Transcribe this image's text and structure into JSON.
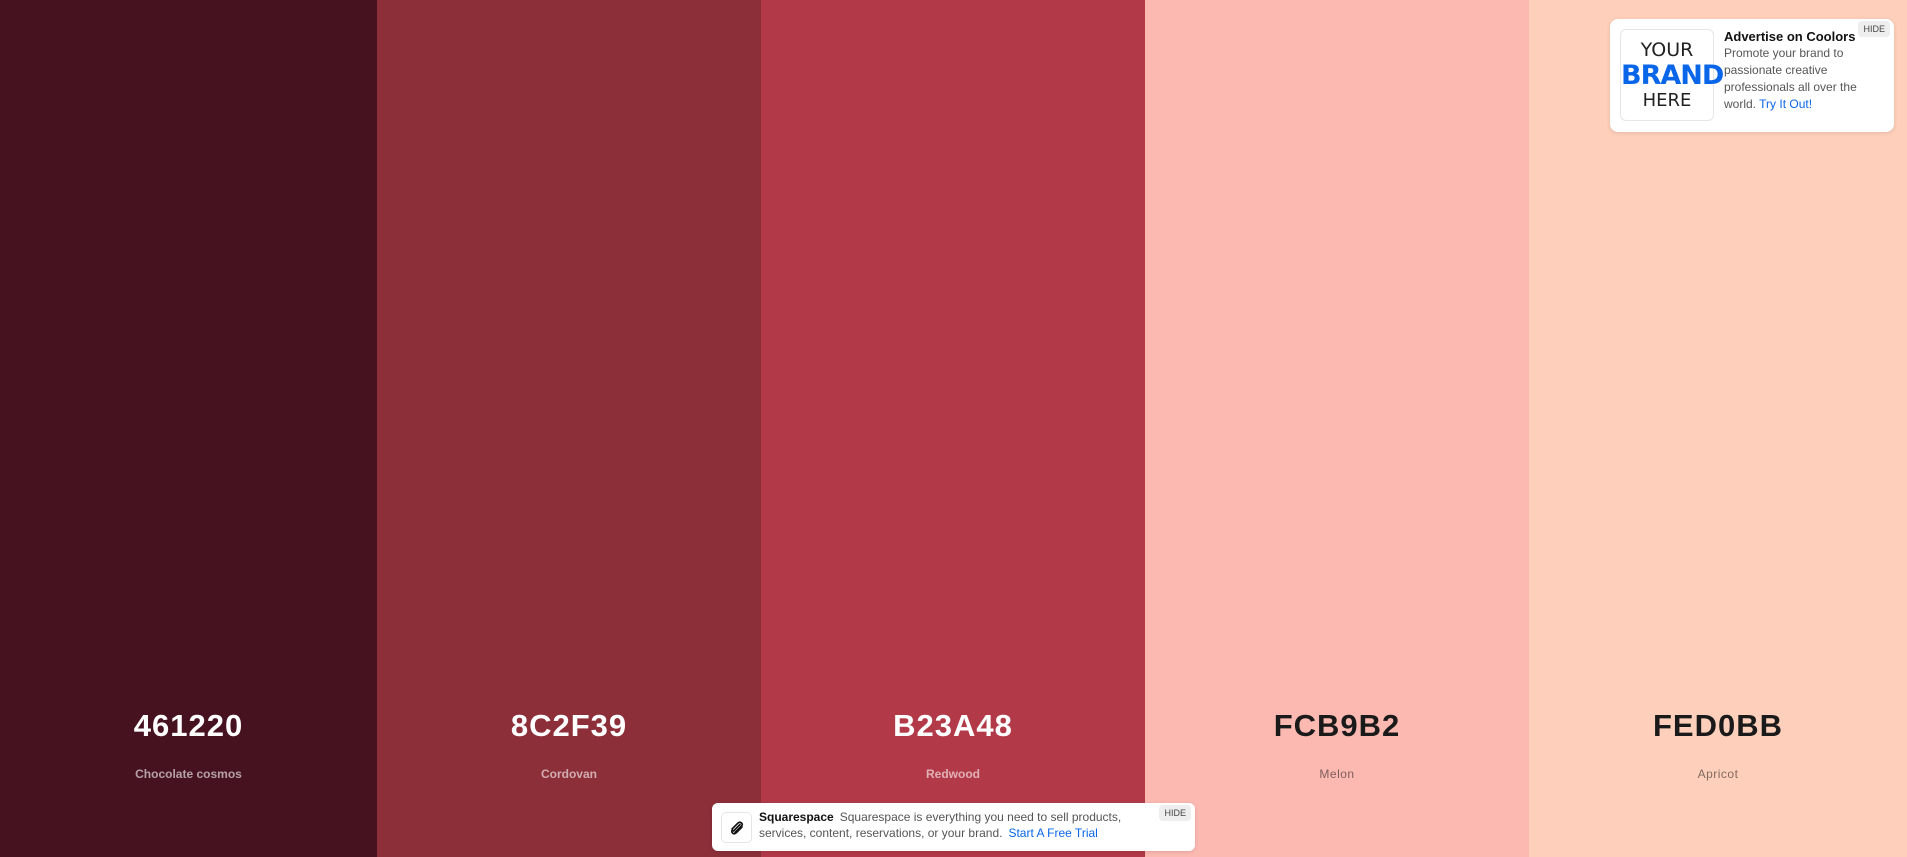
{
  "palette": {
    "swatches": [
      {
        "hex": "461220",
        "name": "Chocolate cosmos",
        "color": "#461220",
        "tone": "dark"
      },
      {
        "hex": "8C2F39",
        "name": "Cordovan",
        "color": "#8C2F39",
        "tone": "dark"
      },
      {
        "hex": "B23A48",
        "name": "Redwood",
        "color": "#B23A48",
        "tone": "dark"
      },
      {
        "hex": "FCB9B2",
        "name": "Melon",
        "color": "#FCB9B2",
        "tone": "light"
      },
      {
        "hex": "FED0BB",
        "name": "Apricot",
        "color": "#FED0BB",
        "tone": "light"
      }
    ]
  },
  "ad": {
    "logo_line1": "YOUR",
    "logo_line2": "BRAND",
    "logo_line3": "HERE",
    "title": "Advertise on Coolors",
    "body": "Promote your brand to passionate creative professionals all over the world.",
    "link": "Try It Out!",
    "hide_label": "HIDE"
  },
  "banner": {
    "brand": "Squarespace",
    "body": "Squarespace is everything you need to sell products, services, content, reservations, or your brand.",
    "link": "Start A Free Trial",
    "hide_label": "HIDE",
    "logo_icon": "squarespace-logo-icon"
  },
  "colors": {
    "link": "#0a66e8"
  }
}
